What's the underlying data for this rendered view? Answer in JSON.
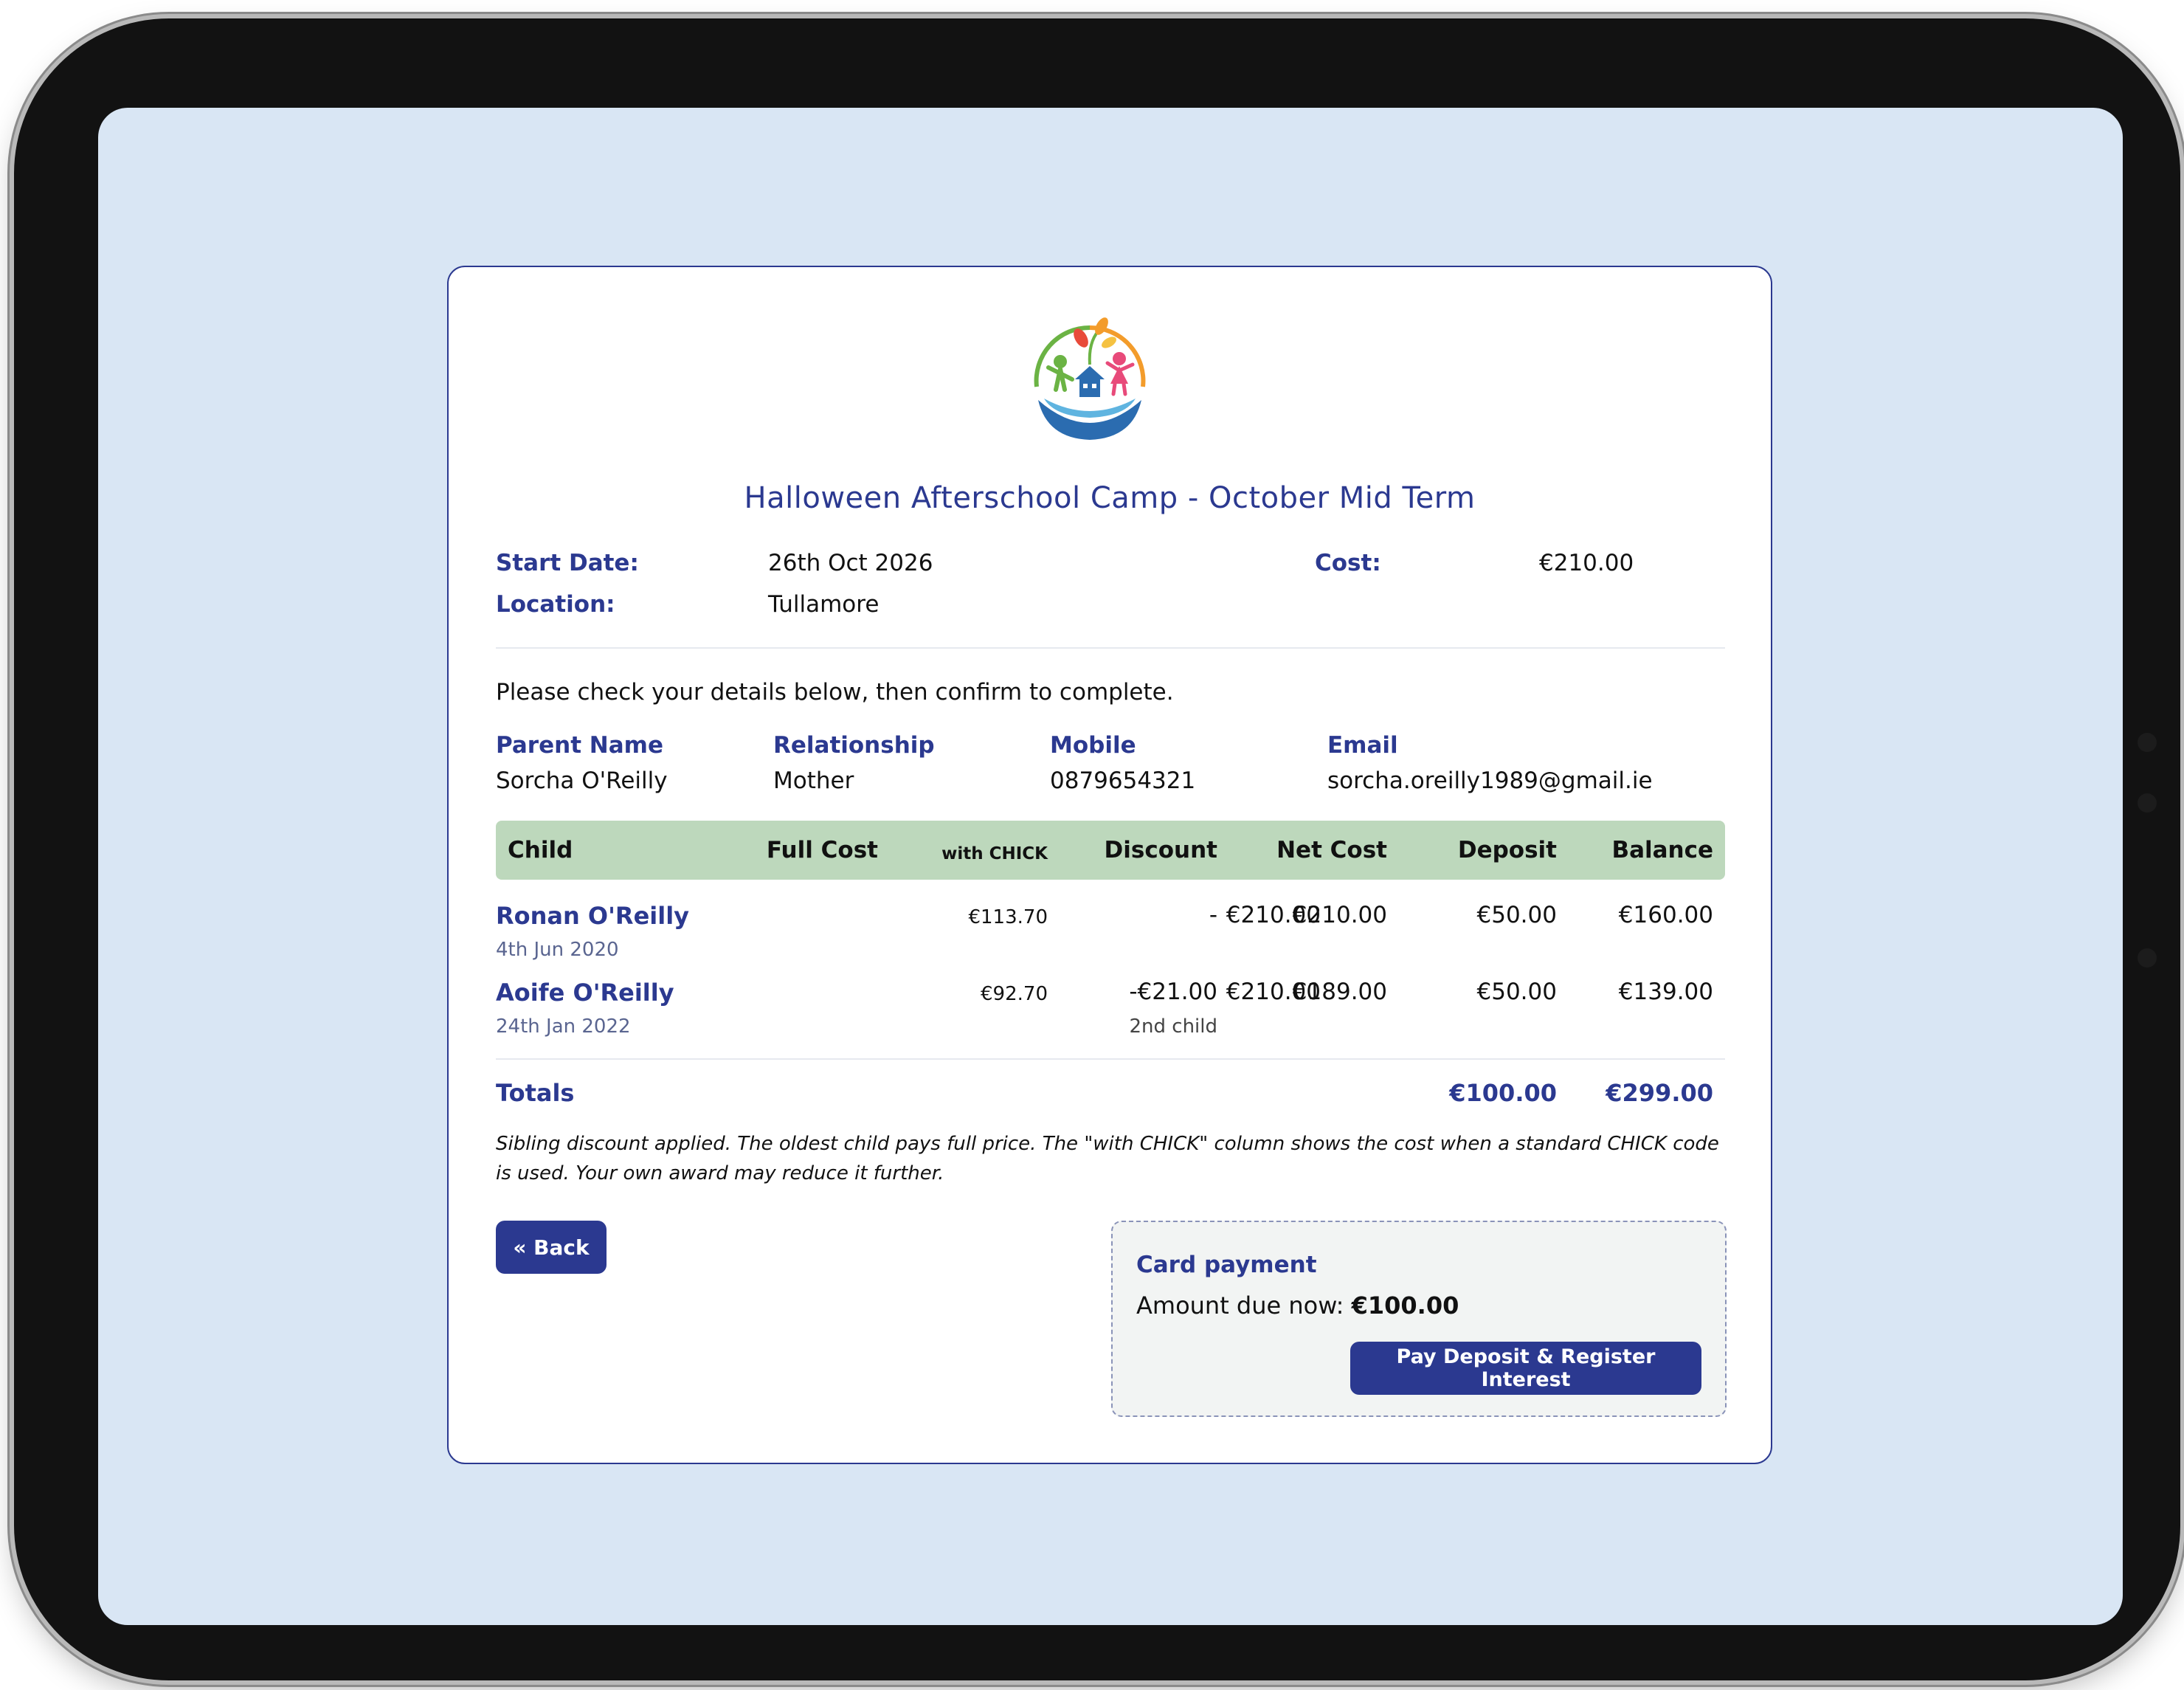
{
  "camp": {
    "title": "Halloween Afterschool Camp - October Mid Term",
    "start_date_label": "Start Date:",
    "start_date": "26th Oct 2026",
    "location_label": "Location:",
    "location": "Tullamore",
    "cost_label": "Cost:",
    "cost": "€210.00"
  },
  "instructions": "Please check your details below, then confirm to complete.",
  "parent": {
    "name_label": "Parent Name",
    "name": "Sorcha O'Reilly",
    "relationship_label": "Relationship",
    "relationship": "Mother",
    "mobile_label": "Mobile",
    "mobile": "0879654321",
    "email_label": "Email",
    "email": "sorcha.oreilly1989@gmail.ie"
  },
  "table": {
    "headers": {
      "child": "Child",
      "full_cost": "Full Cost",
      "with_chick": "with CHICK",
      "discount": "Discount",
      "net_cost": "Net Cost",
      "deposit": "Deposit",
      "balance": "Balance"
    },
    "rows": [
      {
        "name": "Ronan O'Reilly",
        "dob": "4th Jun 2020",
        "full_cost": "€210.00",
        "with_chick": "€113.70",
        "discount": "-",
        "discount_note": "",
        "net_cost": "€210.00",
        "deposit": "€50.00",
        "balance": "€160.00"
      },
      {
        "name": "Aoife O'Reilly",
        "dob": "24th Jan 2022",
        "full_cost": "€210.00",
        "with_chick": "€92.70",
        "discount": "-€21.00",
        "discount_note": "2nd child",
        "net_cost": "€189.00",
        "deposit": "€50.00",
        "balance": "€139.00"
      }
    ],
    "totals_label": "Totals",
    "total_deposit": "€100.00",
    "total_balance": "€299.00"
  },
  "footnote": "Sibling discount applied. The oldest child pays full price. The \"with CHICK\" column shows the cost when a standard CHICK code is used. Your own award may reduce it further.",
  "back_button": "« Back",
  "payment": {
    "title": "Card payment",
    "amount_label": "Amount due now:",
    "amount": "€100.00",
    "button": "Pay Deposit & Register Interest"
  },
  "colors": {
    "brand": "#2b3990",
    "table_header": "#bdd8bc",
    "screen_bg": "#d9e6f4"
  }
}
